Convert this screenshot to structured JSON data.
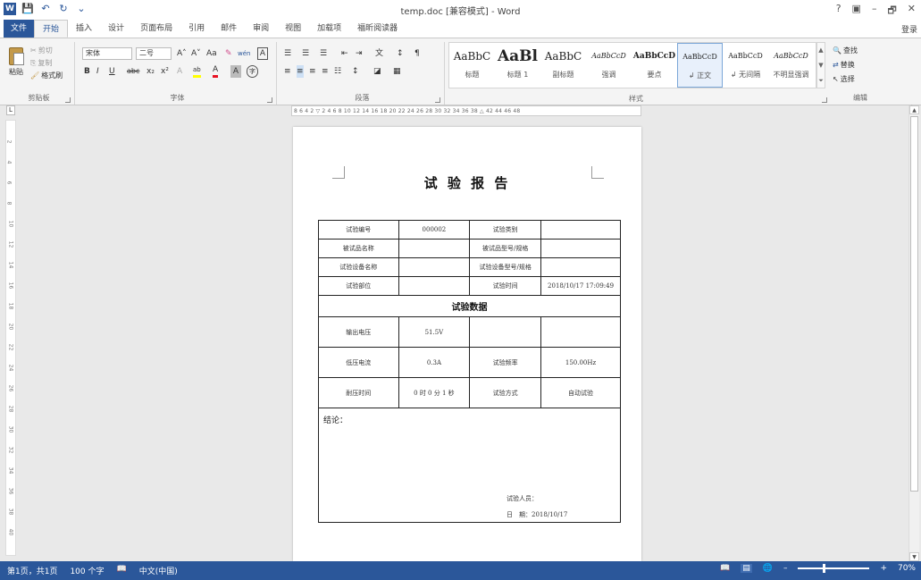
{
  "window": {
    "title": "temp.doc [兼容模式] - Word",
    "controls": [
      "?",
      "▣",
      "–",
      "🗗",
      "✕"
    ],
    "login": "登录"
  },
  "quick_access": {
    "word_icon": "W",
    "save_icon": "💾",
    "undo_icon": "↶",
    "redo_icon": "↻",
    "customize_icon": "⌄"
  },
  "tabs": [
    "文件",
    "开始",
    "插入",
    "设计",
    "页面布局",
    "引用",
    "邮件",
    "审阅",
    "视图",
    "加载项",
    "福昕阅读器"
  ],
  "active_tab": "开始",
  "ribbon": {
    "clipboard": {
      "paste": "粘贴",
      "cut": "剪切",
      "copy": "复制",
      "format_painter": "格式刷",
      "label": "剪贴板"
    },
    "font": {
      "font_name": "宋体",
      "font_size": "二号",
      "grow": "A˄",
      "shrink": "A˅",
      "case": "Aa",
      "clear": "✎",
      "phonetic": "wén",
      "border": "A",
      "bold": "B",
      "italic": "I",
      "underline": "U",
      "strike": "abc",
      "subscript": "x₂",
      "superscript": "x²",
      "effects": "A",
      "highlight": "ab",
      "color": "A",
      "char_shading": "A",
      "enclose": "字",
      "label": "字体"
    },
    "paragraph": {
      "label": "段落",
      "bullets": "☰",
      "numbering": "☰",
      "multilevel": "☰",
      "decrease": "⇤",
      "increase": "⇥",
      "cjk": "文",
      "sort": "↕",
      "marks": "¶",
      "left": "≡",
      "center": "≡",
      "right": "≡",
      "justify": "≡",
      "distribute": "☷",
      "spacing": "↕",
      "shading": "◪",
      "borders": "▦"
    },
    "styles": {
      "label": "样式",
      "items": [
        {
          "sample": "AaBbC",
          "name": "标题"
        },
        {
          "sample": "AaBl",
          "name": "标题 1"
        },
        {
          "sample": "AaBbC",
          "name": "副标题"
        },
        {
          "sample": "AaBbCcD",
          "name": "强调"
        },
        {
          "sample": "AaBbCcD",
          "name": "要点"
        },
        {
          "sample": "AaBbCcD",
          "name": "↲ 正文"
        },
        {
          "sample": "AaBbCcD",
          "name": "↲ 无间隔"
        },
        {
          "sample": "AaBbCcD",
          "name": "不明显强调"
        }
      ],
      "selected_index": 5
    },
    "editing": {
      "find": "查找",
      "replace": "替换",
      "select": "选择",
      "label": "编辑"
    }
  },
  "ruler": {
    "corner": "L",
    "marks": "8  6  4  2  ▽  2  4  6  8  10 12 14 16 18 20 22 24 26 28 30 32 34 36 38 △ 42 44 46 48",
    "vertical_marks": [
      "2",
      "4",
      "6",
      "8",
      "10",
      "12",
      "14",
      "16",
      "18",
      "20",
      "22",
      "24",
      "26",
      "28",
      "30",
      "32",
      "34",
      "36",
      "38",
      "40"
    ]
  },
  "document": {
    "title": "试 验 报 告",
    "rows": [
      [
        "试验编号",
        "000002",
        "试验类别",
        ""
      ],
      [
        "被试品名称",
        "",
        "被试品型号/规格",
        ""
      ],
      [
        "试验设备名称",
        "",
        "试验设备型号/规格",
        ""
      ],
      [
        "试验部位",
        "",
        "试验时间",
        "2018/10/17 17:09:49"
      ]
    ],
    "section_title": "试验数据",
    "data_rows": [
      [
        "输出电压",
        "51.5V",
        "",
        ""
      ],
      [
        "低压电流",
        "0.3A",
        "试验频率",
        "150.00Hz"
      ],
      [
        "耐压时间",
        "0 时 0 分 1 秒",
        "试验方式",
        "自动试验"
      ]
    ],
    "conclusion_label": "结论：",
    "tester_label": "试验人员：",
    "date_label": "日　期：",
    "date_value": "2018/10/17"
  },
  "status": {
    "page": "第1页，共1页",
    "words": "100 个字",
    "proof_icon": "📖",
    "language": "中文(中国)",
    "zoom": "70%",
    "zoom_fraction": 0.7,
    "view_icons": [
      "📖",
      "▤",
      "🌐"
    ]
  }
}
